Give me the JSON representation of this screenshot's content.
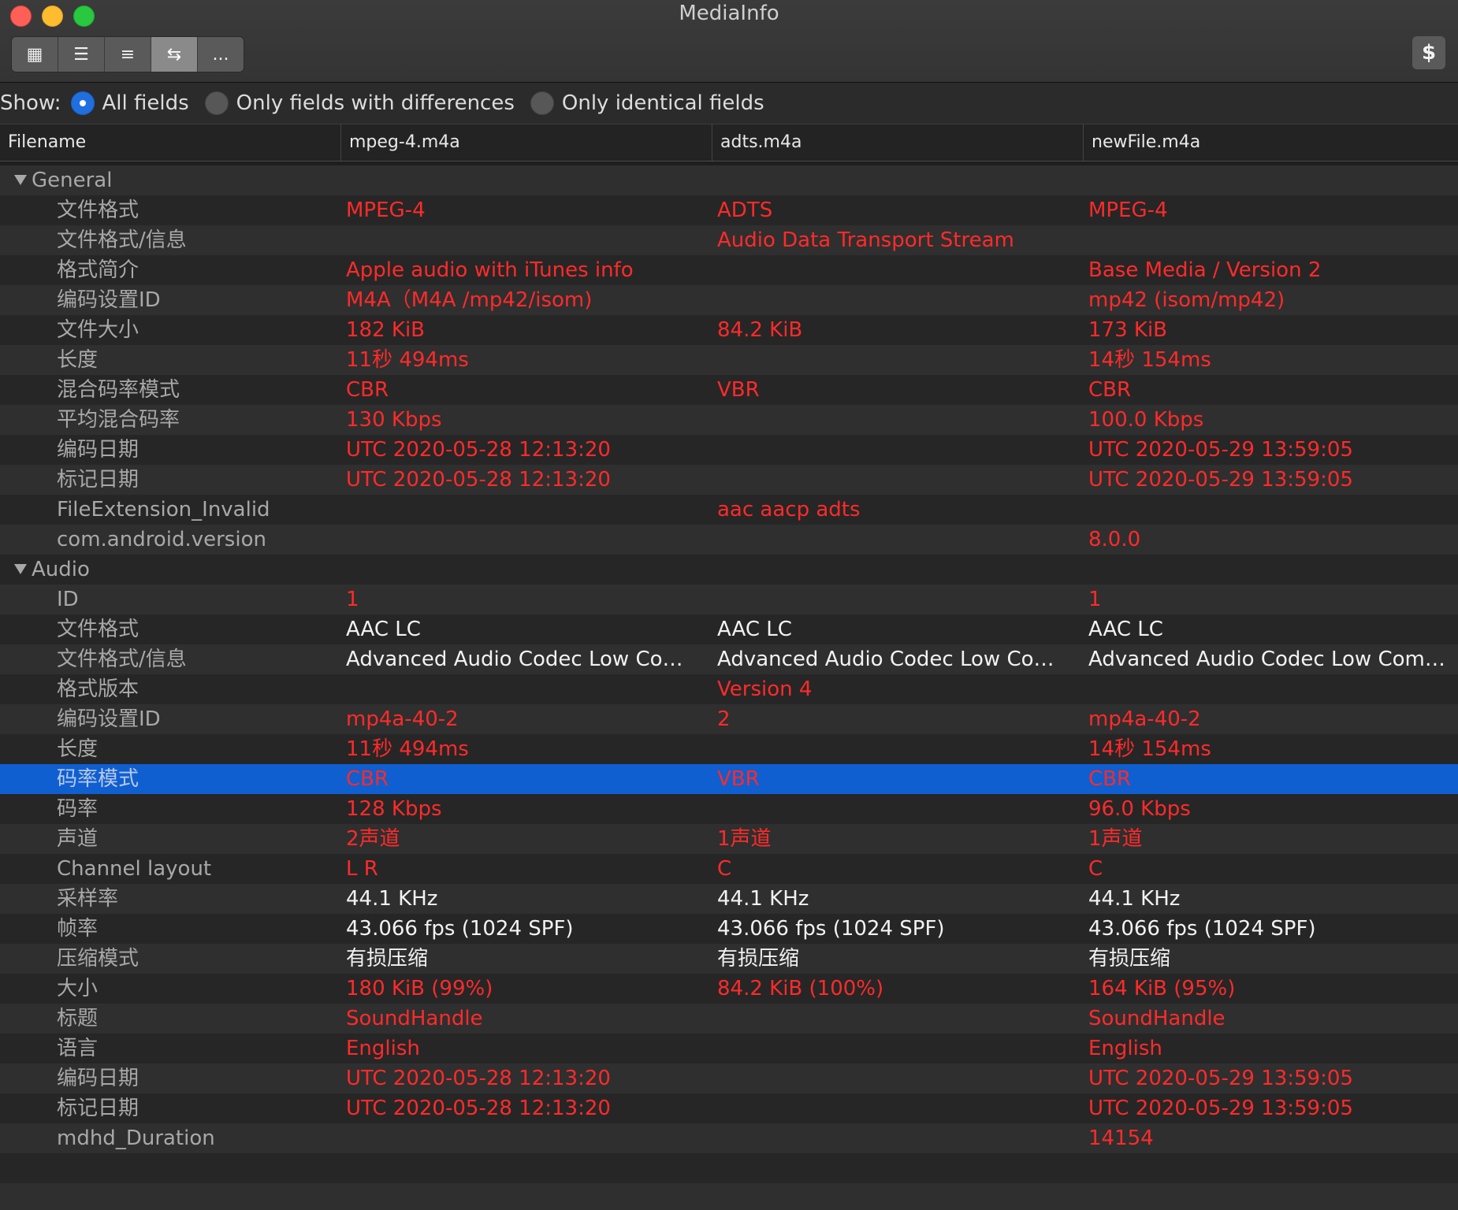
{
  "window": {
    "title": "MediaInfo"
  },
  "toolbar": {
    "buttons": [
      {
        "name": "grid-view",
        "glyph": "▦"
      },
      {
        "name": "outline-view",
        "glyph": "☰"
      },
      {
        "name": "list-view",
        "glyph": "≡"
      },
      {
        "name": "compare-view",
        "glyph": "⇆"
      },
      {
        "name": "more",
        "glyph": "..."
      }
    ],
    "donate_glyph": "$"
  },
  "show": {
    "label": "Show:",
    "options": [
      "All fields",
      "Only fields with differences",
      "Only identical fields"
    ],
    "selected": 0
  },
  "header": {
    "columns": [
      "Filename",
      "mpeg-4.m4a",
      "adts.m4a",
      "newFile.m4a"
    ]
  },
  "sections": [
    {
      "title": "General",
      "rows": [
        {
          "field": "文件格式",
          "values": [
            "MPEG-4",
            "ADTS",
            "MPEG-4"
          ],
          "diff": true
        },
        {
          "field": "文件格式/信息",
          "values": [
            "",
            "Audio Data Transport Stream",
            ""
          ],
          "diff": true
        },
        {
          "field": "格式简介",
          "values": [
            "Apple audio with iTunes info",
            "",
            "Base Media / Version 2"
          ],
          "diff": true
        },
        {
          "field": "编码设置ID",
          "values": [
            "M4A（M4A /mp42/isom)",
            "",
            "mp42 (isom/mp42)"
          ],
          "diff": true
        },
        {
          "field": "文件大小",
          "values": [
            "182 KiB",
            "84.2 KiB",
            "173 KiB"
          ],
          "diff": true
        },
        {
          "field": "长度",
          "values": [
            "11秒 494ms",
            "",
            "14秒 154ms"
          ],
          "diff": true
        },
        {
          "field": "混合码率模式",
          "values": [
            "CBR",
            "VBR",
            "CBR"
          ],
          "diff": true
        },
        {
          "field": "平均混合码率",
          "values": [
            "130 Kbps",
            "",
            "100.0 Kbps"
          ],
          "diff": true
        },
        {
          "field": "编码日期",
          "values": [
            "UTC 2020-05-28 12:13:20",
            "",
            "UTC 2020-05-29 13:59:05"
          ],
          "diff": true
        },
        {
          "field": "标记日期",
          "values": [
            "UTC 2020-05-28 12:13:20",
            "",
            "UTC 2020-05-29 13:59:05"
          ],
          "diff": true
        },
        {
          "field": "FileExtension_Invalid",
          "values": [
            "",
            "aac aacp adts",
            ""
          ],
          "diff": true
        },
        {
          "field": "com.android.version",
          "values": [
            "",
            "",
            "8.0.0"
          ],
          "diff": true
        }
      ]
    },
    {
      "title": "Audio",
      "rows": [
        {
          "field": "ID",
          "values": [
            "1",
            "",
            "1"
          ],
          "diff": true
        },
        {
          "field": "文件格式",
          "values": [
            "AAC LC",
            "AAC LC",
            "AAC LC"
          ],
          "diff": false
        },
        {
          "field": "文件格式/信息",
          "values": [
            "Advanced Audio Codec Low Compl...",
            "Advanced Audio Codec Low Compl...",
            "Advanced Audio Codec Low Compl..."
          ],
          "diff": false
        },
        {
          "field": "格式版本",
          "values": [
            "",
            "Version 4",
            ""
          ],
          "diff": true
        },
        {
          "field": "编码设置ID",
          "values": [
            "mp4a-40-2",
            "2",
            "mp4a-40-2"
          ],
          "diff": true
        },
        {
          "field": "长度",
          "values": [
            "11秒 494ms",
            "",
            "14秒 154ms"
          ],
          "diff": true
        },
        {
          "field": "码率模式",
          "values": [
            "CBR",
            "VBR",
            "CBR"
          ],
          "diff": true,
          "selected": true
        },
        {
          "field": "码率",
          "values": [
            "128 Kbps",
            "",
            "96.0 Kbps"
          ],
          "diff": true
        },
        {
          "field": "声道",
          "values": [
            "2声道",
            "1声道",
            "1声道"
          ],
          "diff": true
        },
        {
          "field": "Channel layout",
          "values": [
            "L R",
            "C",
            "C"
          ],
          "diff": true
        },
        {
          "field": "采样率",
          "values": [
            "44.1 KHz",
            "44.1 KHz",
            "44.1 KHz"
          ],
          "diff": false
        },
        {
          "field": "帧率",
          "values": [
            "43.066 fps (1024 SPF)",
            "43.066 fps (1024 SPF)",
            "43.066 fps (1024 SPF)"
          ],
          "diff": false
        },
        {
          "field": "压缩模式",
          "values": [
            "有损压缩",
            "有损压缩",
            "有损压缩"
          ],
          "diff": false
        },
        {
          "field": "大小",
          "values": [
            "180 KiB (99%)",
            "84.2 KiB (100%)",
            "164 KiB (95%)"
          ],
          "diff": true
        },
        {
          "field": "标题",
          "values": [
            "SoundHandle",
            "",
            "SoundHandle"
          ],
          "diff": true
        },
        {
          "field": "语言",
          "values": [
            "English",
            "",
            "English"
          ],
          "diff": true
        },
        {
          "field": "编码日期",
          "values": [
            "UTC 2020-05-28 12:13:20",
            "",
            "UTC 2020-05-29 13:59:05"
          ],
          "diff": true
        },
        {
          "field": "标记日期",
          "values": [
            "UTC 2020-05-28 12:13:20",
            "",
            "UTC 2020-05-29 13:59:05"
          ],
          "diff": true
        },
        {
          "field": "mdhd_Duration",
          "values": [
            "",
            "",
            "14154"
          ],
          "diff": true
        }
      ]
    }
  ],
  "colors": {
    "diff": "#ff2a2a",
    "same": "#f2f2f2",
    "selection": "#0f5fd0",
    "radio_on": "#1f6fe0"
  }
}
